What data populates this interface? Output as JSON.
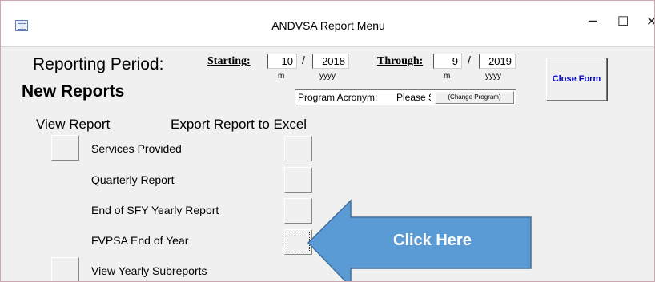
{
  "window": {
    "title": "ANDVSA Report Menu",
    "controls": {
      "minimize": "–",
      "maximize": "☐",
      "close": "✕"
    }
  },
  "period": {
    "label": "Reporting Period:",
    "starting_label": "Starting:",
    "start_month": "10",
    "start_year": "2018",
    "through_label": "Through:",
    "end_month": "9",
    "end_year": "2019",
    "separator": "/",
    "month_hint": "m",
    "year_hint": "yyyy"
  },
  "section_title": "New Reports",
  "program": {
    "acronym_label": "Program Acronym:",
    "acronym_value": "Please S",
    "change_button": "(Change Program)"
  },
  "close_form_label": "Close Form",
  "columns": {
    "view": "View Report",
    "export": "Export Report to Excel"
  },
  "reports": [
    {
      "label": "Services Provided"
    },
    {
      "label": "Quarterly Report"
    },
    {
      "label": "End of SFY Yearly Report"
    },
    {
      "label": "FVPSA End of Year"
    },
    {
      "label": "View Yearly Subreports"
    }
  ],
  "callout": {
    "text": "Click Here",
    "color": "#5b9bd5"
  }
}
